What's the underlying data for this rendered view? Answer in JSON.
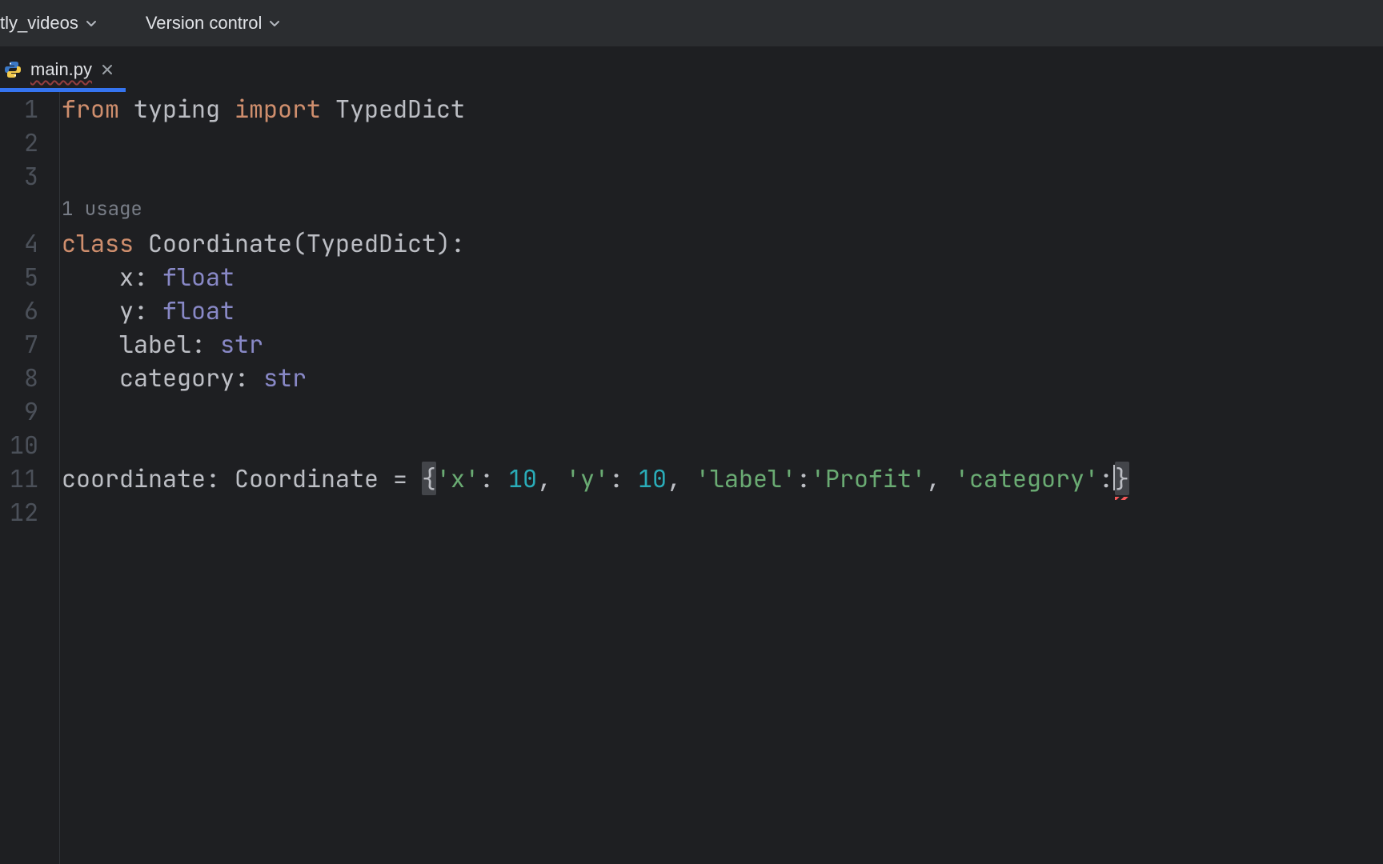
{
  "topbar": {
    "project_label": "tly_videos",
    "vcs_label": "Version control"
  },
  "tab": {
    "filename": "main.py"
  },
  "line_numbers": [
    "1",
    "2",
    "3",
    "",
    "4",
    "5",
    "6",
    "7",
    "8",
    "9",
    "10",
    "11",
    "12"
  ],
  "usage_hint": "1 usage",
  "code": {
    "l1_from": "from",
    "l1_typing": "typing",
    "l1_import": "import",
    "l1_typeddict": "TypedDict",
    "l4_class": "class",
    "l4_name": "Coordinate",
    "l4_base": "TypedDict",
    "l5_name": "x",
    "l5_type": "float",
    "l6_name": "y",
    "l6_type": "float",
    "l7_name": "label",
    "l7_type": "str",
    "l8_name": "category",
    "l8_type": "str",
    "l11_var": "coordinate",
    "l11_type": "Coordinate",
    "l11_kx": "'x'",
    "l11_vx": "10",
    "l11_ky": "'y'",
    "l11_vy": "10",
    "l11_klabel": "'label'",
    "l11_vlabel": "'Profit'",
    "l11_kcategory": "'category'"
  }
}
